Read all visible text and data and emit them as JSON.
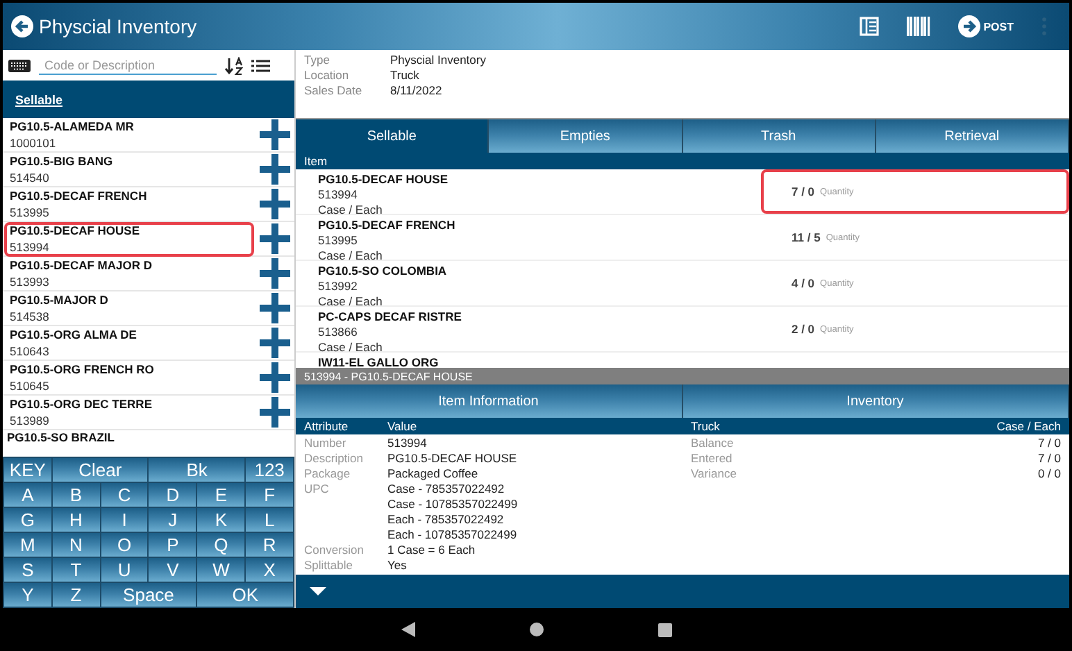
{
  "app_bar": {
    "title": "Physcial Inventory",
    "post_label": "POST"
  },
  "search": {
    "placeholder": "Code or Description"
  },
  "list_header": "Sellable",
  "products": [
    {
      "name": "PG10.5-ALAMEDA MR",
      "code": "1000101",
      "highlighted": false
    },
    {
      "name": "PG10.5-BIG BANG",
      "code": "514540",
      "highlighted": false
    },
    {
      "name": "PG10.5-DECAF FRENCH",
      "code": "513995",
      "highlighted": false
    },
    {
      "name": "PG10.5-DECAF HOUSE",
      "code": "513994",
      "highlighted": true
    },
    {
      "name": "PG10.5-DECAF MAJOR D",
      "code": "513993",
      "highlighted": false
    },
    {
      "name": "PG10.5-MAJOR D",
      "code": "514538",
      "highlighted": false
    },
    {
      "name": "PG10.5-ORG  ALMA DE",
      "code": "510643",
      "highlighted": false
    },
    {
      "name": "PG10.5-ORG FRENCH RO",
      "code": "510645",
      "highlighted": false
    },
    {
      "name": "PG10.5-ORG DEC TERRE",
      "code": "513989",
      "highlighted": false
    },
    {
      "name": "PG10.5-SO BRAZIL",
      "highlighted": false
    }
  ],
  "keyboard": [
    [
      {
        "label": "KEY",
        "wide": false
      },
      {
        "label": "Clear",
        "wide": true
      },
      {
        "label": "Bk",
        "wide": true
      },
      {
        "label": "123",
        "wide": false
      }
    ],
    [
      {
        "label": "A",
        "wide": false
      },
      {
        "label": "B",
        "wide": false
      },
      {
        "label": "C",
        "wide": false
      },
      {
        "label": "D",
        "wide": false
      },
      {
        "label": "E",
        "wide": false
      },
      {
        "label": "F",
        "wide": false
      }
    ],
    [
      {
        "label": "G",
        "wide": false
      },
      {
        "label": "H",
        "wide": false
      },
      {
        "label": "I",
        "wide": false
      },
      {
        "label": "J",
        "wide": false
      },
      {
        "label": "K",
        "wide": false
      },
      {
        "label": "L",
        "wide": false
      }
    ],
    [
      {
        "label": "M",
        "wide": false
      },
      {
        "label": "N",
        "wide": false
      },
      {
        "label": "O",
        "wide": false
      },
      {
        "label": "P",
        "wide": false
      },
      {
        "label": "Q",
        "wide": false
      },
      {
        "label": "R",
        "wide": false
      }
    ],
    [
      {
        "label": "S",
        "wide": false
      },
      {
        "label": "T",
        "wide": false
      },
      {
        "label": "U",
        "wide": false
      },
      {
        "label": "V",
        "wide": false
      },
      {
        "label": "W",
        "wide": false
      },
      {
        "label": "X",
        "wide": false
      }
    ],
    [
      {
        "label": "Y",
        "wide": false
      },
      {
        "label": "Z",
        "wide": false
      },
      {
        "label": "Space",
        "wide": true
      },
      {
        "label": "OK",
        "wide": true
      }
    ]
  ],
  "document": [
    {
      "label": "Type",
      "value": "Physcial Inventory"
    },
    {
      "label": "Location",
      "value": "Truck"
    },
    {
      "label": "Sales Date",
      "value": "8/11/2022"
    }
  ],
  "tabs": [
    {
      "label": "Sellable",
      "selected": true
    },
    {
      "label": "Empties",
      "selected": false
    },
    {
      "label": "Trash",
      "selected": false
    },
    {
      "label": "Retrieval",
      "selected": false
    }
  ],
  "item_list": {
    "column": "Item",
    "rows": [
      {
        "name": "PG10.5-DECAF HOUSE",
        "code": "513994",
        "unit": "Case / Each",
        "quantity": "7 / 0",
        "quantity_label": "Quantity",
        "highlighted": true
      },
      {
        "name": "PG10.5-DECAF FRENCH",
        "code": "513995",
        "unit": "Case / Each",
        "quantity": "11 / 5",
        "quantity_label": "Quantity",
        "highlighted": false
      },
      {
        "name": "PG10.5-SO COLOMBIA",
        "code": "513992",
        "unit": "Case / Each",
        "quantity": "4 / 0",
        "quantity_label": "Quantity",
        "highlighted": false
      },
      {
        "name": "PC-CAPS DECAF RISTRE",
        "code": "513866",
        "unit": "Case / Each",
        "quantity": "2 / 0",
        "quantity_label": "Quantity",
        "highlighted": false
      },
      {
        "name": "IW11-EL GALLO ORG"
      }
    ]
  },
  "selected_item": "513994 - PG10.5-DECAF HOUSE",
  "detail_tabs": [
    {
      "label": "Item Information",
      "selected": false
    },
    {
      "label": "Inventory",
      "selected": false
    }
  ],
  "attributes": {
    "columns": [
      "Attribute",
      "Value"
    ],
    "rows": [
      {
        "attribute": "Number",
        "value": "513994"
      },
      {
        "attribute": "Description",
        "value": "PG10.5-DECAF HOUSE"
      },
      {
        "attribute": "Package",
        "value": "Packaged Coffee"
      },
      {
        "attribute": "UPC",
        "value": "Case - 785357022492"
      },
      {
        "value": "Case - 10785357022499"
      },
      {
        "value": "Each - 785357022492"
      },
      {
        "value": "Each - 10785357022499"
      },
      {
        "attribute": "Conversion",
        "value": "1 Case = 6 Each"
      },
      {
        "attribute": "Splittable",
        "value": "Yes"
      }
    ]
  },
  "inventory": {
    "columns": [
      "Truck",
      "Case / Each"
    ],
    "rows": [
      {
        "label": "Balance",
        "value": "7 / 0"
      },
      {
        "label": "Entered",
        "value": "7 / 0"
      },
      {
        "label": "Variance",
        "value": "0 / 0"
      }
    ]
  }
}
